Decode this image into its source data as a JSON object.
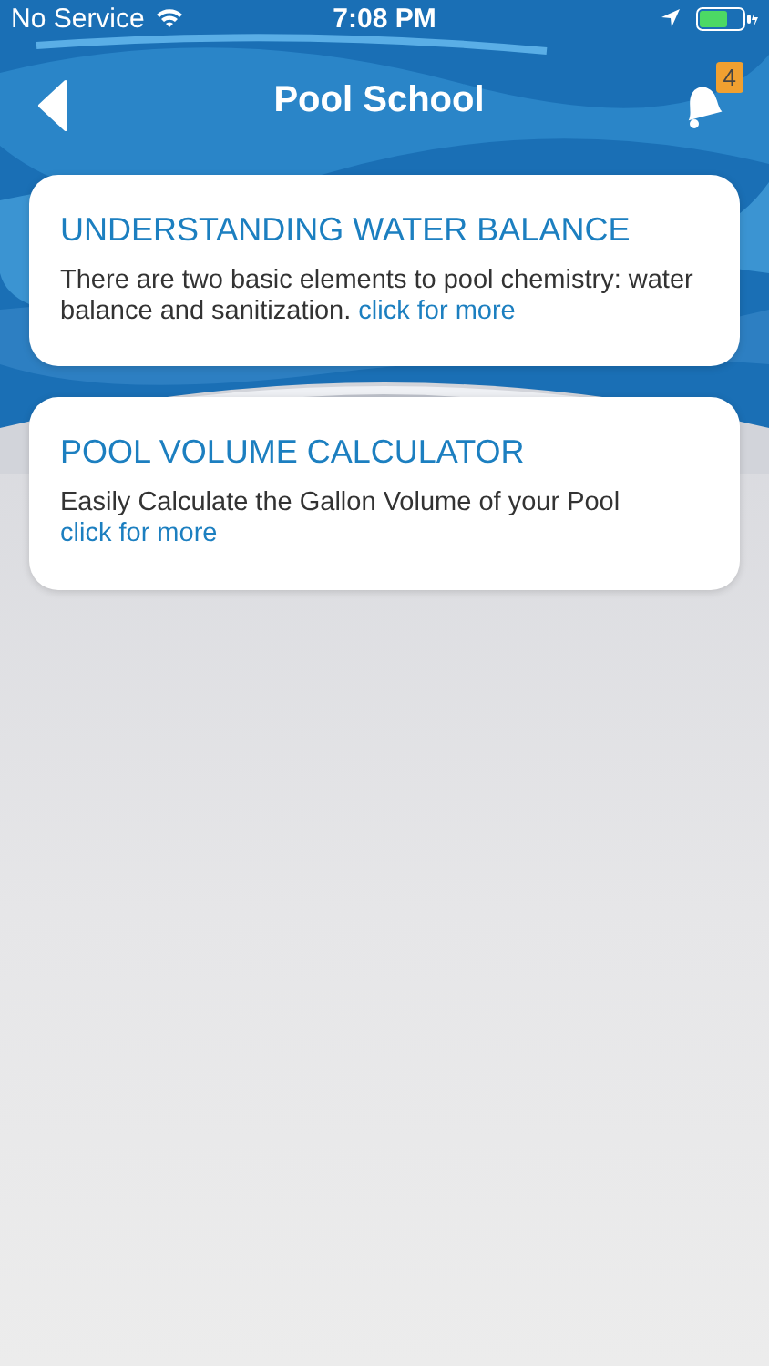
{
  "status_bar": {
    "carrier": "No Service",
    "time": "7:08 PM"
  },
  "header": {
    "title": "Pool School",
    "badge": "4"
  },
  "cards": [
    {
      "title": "UNDERSTANDING WATER BALANCE",
      "text": "There are two basic elements to pool chemistry: water balance and sanitization.",
      "link": "click for more"
    },
    {
      "title": "POOL VOLUME CALCULATOR",
      "text": "Easily Calculate the Gallon Volume of your Pool",
      "link": "click for more"
    }
  ]
}
